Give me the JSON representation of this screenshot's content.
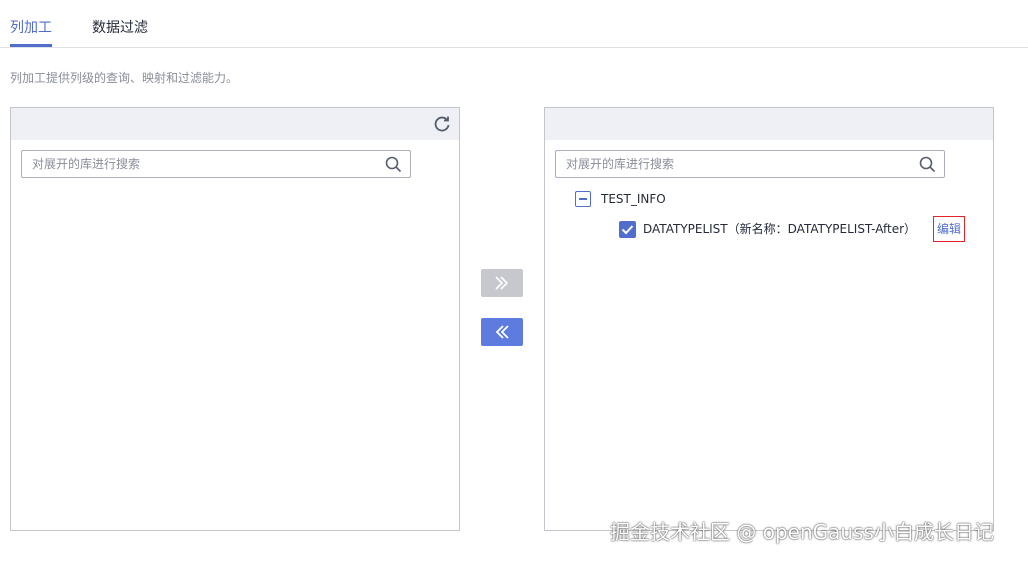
{
  "tabs": [
    {
      "label": "列加工",
      "active": true
    },
    {
      "label": "数据过滤",
      "active": false
    }
  ],
  "description": "列加工提供列级的查询、映射和过滤能力。",
  "left_panel": {
    "search_placeholder": "对展开的库进行搜索",
    "refresh_icon": "refresh-icon"
  },
  "right_panel": {
    "search_placeholder": "对展开的库进行搜索",
    "tree": {
      "root_label": "TEST_INFO",
      "child_label": "DATATYPELIST（新名称：DATATYPELIST-After）",
      "child_checked": true,
      "edit_label": "编辑"
    }
  },
  "transfer": {
    "move_right_icon": "double-chevron-right-icon",
    "move_left_icon": "double-chevron-left-icon"
  },
  "colors": {
    "accent": "#526ecc",
    "button_primary": "#5e7ce0",
    "button_disabled": "#c6c8cd",
    "highlight_border": "#e0262b"
  },
  "watermark": "掘金技术社区 @ openGauss小白成长日记"
}
